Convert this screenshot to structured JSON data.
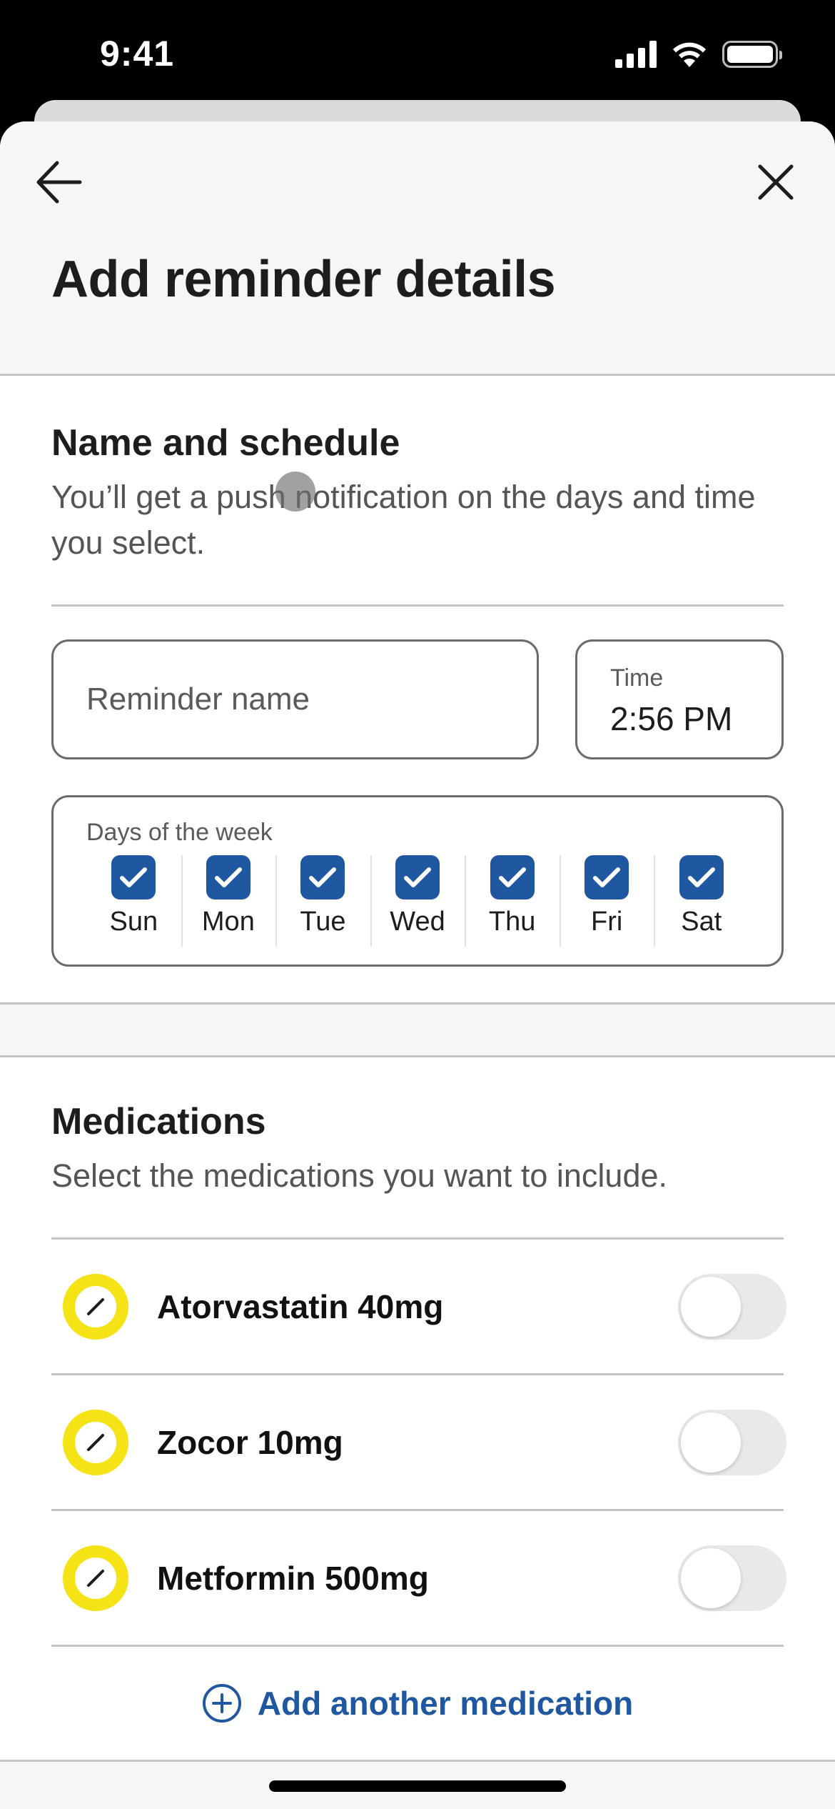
{
  "status_bar": {
    "time": "9:41",
    "icons": [
      "cellular-signal-icon",
      "wifi-icon",
      "battery-icon"
    ]
  },
  "header": {
    "back_icon": "arrow-left-icon",
    "close_icon": "close-icon",
    "title": "Add reminder details"
  },
  "schedule": {
    "title": "Name and schedule",
    "description": "You’ll get a push notification on the days and time you select.",
    "reminder_name": {
      "value": "",
      "placeholder": "Reminder name"
    },
    "time": {
      "label": "Time",
      "value": "2:56 PM"
    },
    "days": {
      "label": "Days of the week",
      "items": [
        {
          "label": "Sun",
          "checked": true
        },
        {
          "label": "Mon",
          "checked": true
        },
        {
          "label": "Tue",
          "checked": true
        },
        {
          "label": "Wed",
          "checked": true
        },
        {
          "label": "Thu",
          "checked": true
        },
        {
          "label": "Fri",
          "checked": true
        },
        {
          "label": "Sat",
          "checked": true
        }
      ]
    }
  },
  "medications": {
    "title": "Medications",
    "description": "Select the medications you want to include.",
    "items": [
      {
        "name": "Atorvastatin 40mg",
        "icon": "pill-icon",
        "enabled": false
      },
      {
        "name": "Zocor 10mg",
        "icon": "pill-icon",
        "enabled": false
      },
      {
        "name": "Metformin 500mg",
        "icon": "pill-icon",
        "enabled": false
      }
    ],
    "add_button": {
      "label": "Add another medication",
      "icon": "plus-circle-icon"
    }
  },
  "colors": {
    "accent_blue": "#1f58a0",
    "pill_yellow": "#f5e316",
    "sheet_background": "#f7f6f4",
    "toggle_off": "#e9e9eb"
  }
}
